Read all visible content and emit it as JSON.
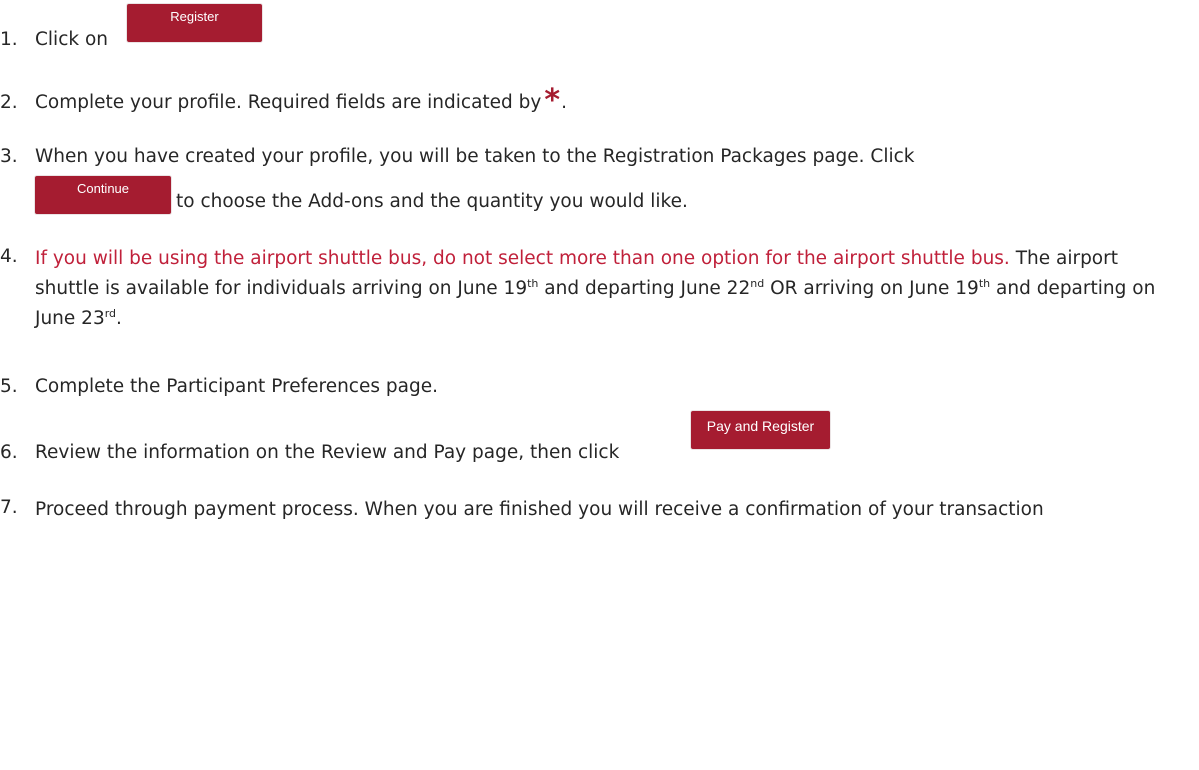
{
  "steps": [
    {
      "num": "1.",
      "text": "Click on",
      "button": "Register"
    },
    {
      "num": "2.",
      "text": "Complete your profile. Required fields are indicated by",
      "marker": "*",
      "after": "."
    },
    {
      "num": "3.",
      "text": "When you have created your profile, you will be taken to the Registration Packages page.  Click",
      "button": "Continue",
      "text2": "to choose the Add-ons and the quantity you would like."
    },
    {
      "num": "4.",
      "warning": "If you will be using the airport shuttle bus, do not select more than one option for the airport shuttle bus.",
      "t1": "  The airport shuttle is available for individuals arriving on June 19",
      "s1": "th",
      "t2": " and departing June 22",
      "s2": "nd",
      "t3": " OR arriving on June 19",
      "s3": "th",
      "t4": " and departing on June 23",
      "s4": "rd",
      "t5": "."
    },
    {
      "num": "5.",
      "text": "Complete the Participant Preferences page."
    },
    {
      "num": "6.",
      "text": "Review the information on the Review and Pay page, then click",
      "button": "Pay and Register"
    },
    {
      "num": "7.",
      "text": "Proceed through payment process.  When you are finished you will receive a confirmation of your transaction"
    }
  ]
}
